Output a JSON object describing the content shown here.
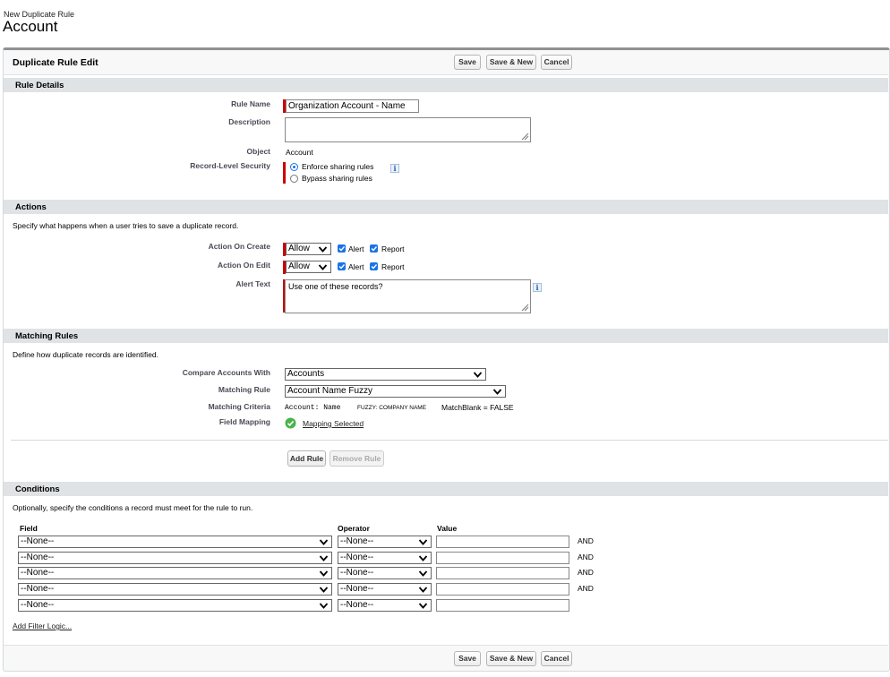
{
  "header": {
    "subtitle": "New Duplicate Rule",
    "title": "Account"
  },
  "page_block": {
    "title": "Duplicate Rule Edit"
  },
  "buttons": {
    "save": "Save",
    "save_new": "Save & New",
    "cancel": "Cancel"
  },
  "rule_details": {
    "heading": "Rule Details",
    "rule_name_label": "Rule Name",
    "rule_name_value": "Organization Account - Name",
    "description_label": "Description",
    "description_value": "",
    "object_label": "Object",
    "object_value": "Account",
    "security_label": "Record-Level Security",
    "security_options": [
      "Enforce sharing rules",
      "Bypass sharing rules"
    ],
    "security_selected": "Enforce sharing rules"
  },
  "actions": {
    "heading": "Actions",
    "help": "Specify what happens when a user tries to save a duplicate record.",
    "create_label": "Action On Create",
    "create_value": "Allow",
    "edit_label": "Action On Edit",
    "edit_value": "Allow",
    "alert_label": "Alert",
    "report_label": "Report",
    "alert_text_label": "Alert Text",
    "alert_text_value": "Use one of these records?"
  },
  "matching": {
    "heading": "Matching Rules",
    "help": "Define how duplicate records are identified.",
    "compare_label": "Compare Accounts With",
    "compare_value": "Accounts",
    "rule_label": "Matching Rule",
    "rule_value": "Account Name Fuzzy",
    "criteria_label": "Matching Criteria",
    "criteria_field": "Account: Name",
    "criteria_method": "FUZZY: COMPANY NAME",
    "criteria_blank": "MatchBlank = FALSE",
    "mapping_label": "Field Mapping",
    "mapping_link": "Mapping Selected",
    "add_rule": "Add Rule",
    "remove_rule": "Remove Rule"
  },
  "conditions": {
    "heading": "Conditions",
    "help": "Optionally, specify the conditions a record must meet for the rule to run.",
    "col_field": "Field",
    "col_operator": "Operator",
    "col_value": "Value",
    "rows": [
      {
        "field": "--None--",
        "operator": "--None--",
        "value": "",
        "join": "AND"
      },
      {
        "field": "--None--",
        "operator": "--None--",
        "value": "",
        "join": "AND"
      },
      {
        "field": "--None--",
        "operator": "--None--",
        "value": "",
        "join": "AND"
      },
      {
        "field": "--None--",
        "operator": "--None--",
        "value": "",
        "join": "AND"
      },
      {
        "field": "--None--",
        "operator": "--None--",
        "value": "",
        "join": ""
      }
    ],
    "filter_logic_link": "Add Filter Logic..."
  }
}
